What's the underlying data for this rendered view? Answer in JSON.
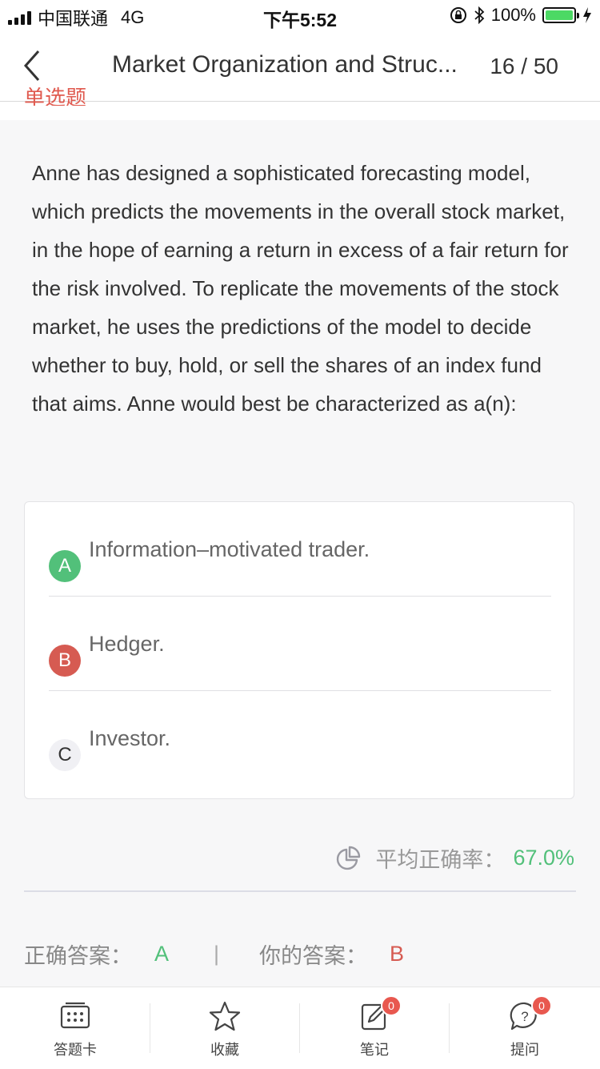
{
  "status_bar": {
    "carrier": "中国联通",
    "network": "4G",
    "time": "下午5:52",
    "battery": "100%"
  },
  "nav": {
    "title": "Market Organization and Struc...",
    "counter": "16 / 50"
  },
  "question": {
    "type_label": "单选题",
    "text": "Anne has designed a sophisticated forecasting model, which predicts the movements in the overall stock market, in the hope of earning a return in excess of a fair return for the risk involved. To replicate the movements of the stock market, he uses the predictions of the model to decide whether to buy, hold, or sell the shares of an index fund that aims. Anne would best be characterized as a(n):",
    "options": [
      {
        "letter": "A",
        "text": "Information–motivated trader.",
        "state": "correct"
      },
      {
        "letter": "B",
        "text": "Hedger.",
        "state": "wrong"
      },
      {
        "letter": "C",
        "text": "Investor.",
        "state": "neutral"
      }
    ]
  },
  "stats": {
    "label": "平均正确率：",
    "value": "67.0%"
  },
  "answers": {
    "correct_label": "正确答案：",
    "correct_value": "A",
    "separator": "|",
    "yours_label": "你的答案：",
    "yours_value": "B"
  },
  "tabbar": {
    "items": [
      {
        "label": "答题卡",
        "icon": "answer-card-icon"
      },
      {
        "label": "收藏",
        "icon": "star-icon"
      },
      {
        "label": "笔记",
        "icon": "note-icon",
        "badge": "0"
      },
      {
        "label": "提问",
        "icon": "question-bubble-icon",
        "badge": "0"
      }
    ]
  },
  "colors": {
    "correct": "#52c07a",
    "wrong": "#d65b52",
    "badge": "#e8584f",
    "battery": "#4cd964"
  }
}
